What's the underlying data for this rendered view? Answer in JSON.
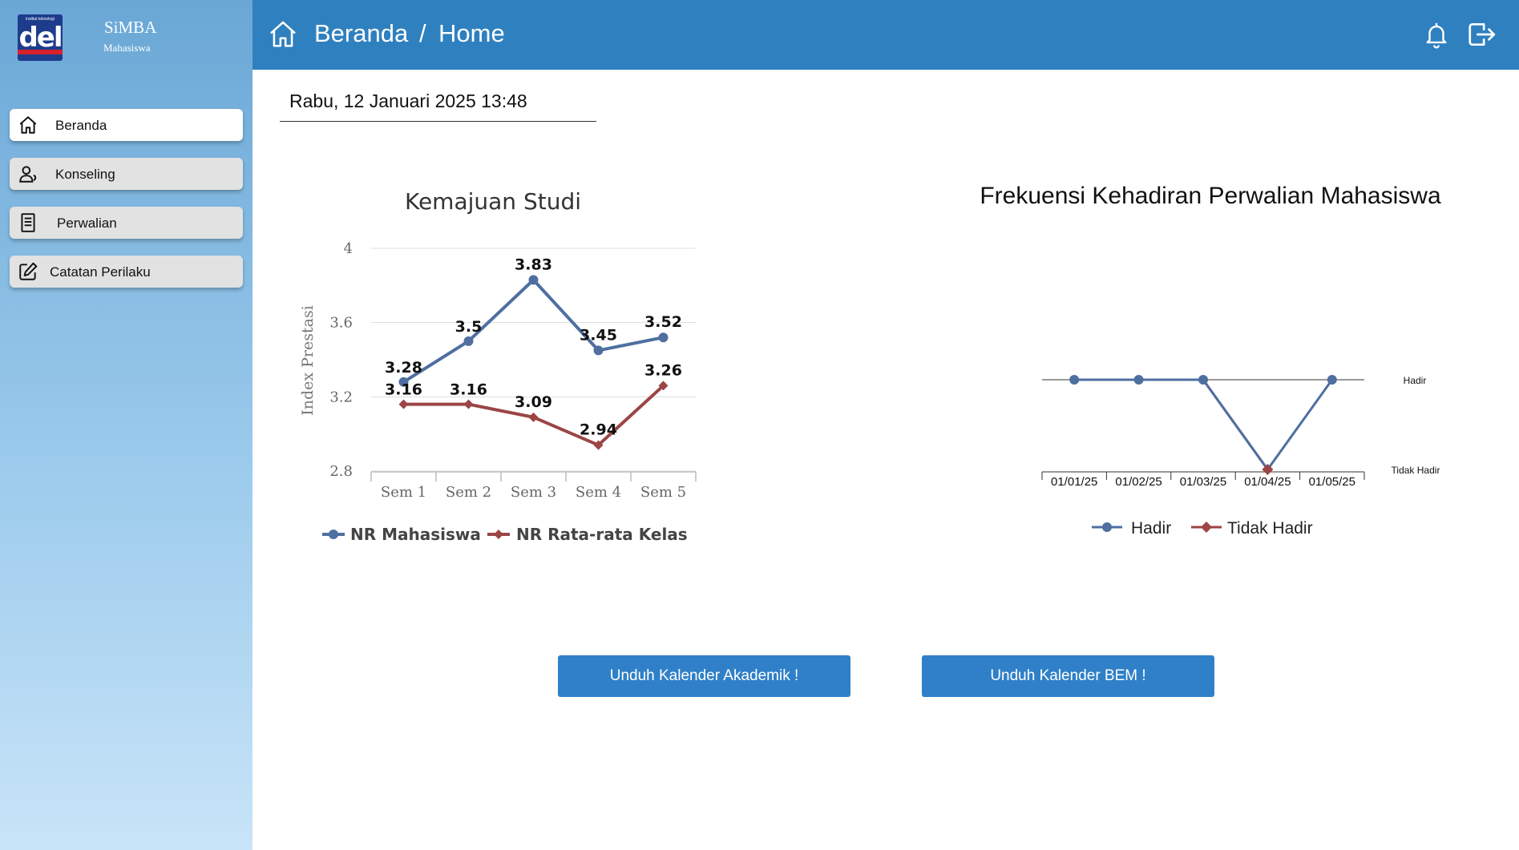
{
  "app": {
    "logo_top_text": "institut teknologi",
    "logo_text": "del",
    "title": "SiMBA",
    "subtitle": "Mahasiswa"
  },
  "sidebar": {
    "items": [
      {
        "label": "Beranda",
        "icon": "home-icon",
        "active": true
      },
      {
        "label": "Konseling",
        "icon": "user-icon",
        "active": false
      },
      {
        "label": "Perwalian",
        "icon": "document-icon",
        "active": false
      },
      {
        "label": "Catatan Perilaku",
        "icon": "edit-icon",
        "active": false
      }
    ]
  },
  "header": {
    "breadcrumb": [
      "Beranda",
      "/",
      "Home"
    ],
    "icons": [
      "home-icon",
      "bell-icon",
      "logout-icon"
    ]
  },
  "date_text": "Rabu, 12 Januari 2025 13:48",
  "colors": {
    "header": "#2f80bf",
    "series_blue": "#4e6fa0",
    "series_red": "#9c4545",
    "button": "#2f80c8"
  },
  "chart_data": [
    {
      "type": "line",
      "title": "Kemajuan Studi",
      "xlabel": "",
      "ylabel": "Index Prestasi",
      "categories": [
        "Sem 1",
        "Sem 2",
        "Sem 3",
        "Sem 4",
        "Sem 5"
      ],
      "y_ticks": [
        "4",
        "3.6",
        "3.2",
        "2.8"
      ],
      "ylim": [
        2.8,
        4
      ],
      "grid": true,
      "legend_position": "bottom",
      "series": [
        {
          "name": "NR Mahasiswa",
          "values": [
            3.28,
            3.5,
            3.83,
            3.45,
            3.52
          ],
          "labels": [
            "3.28",
            "3.5",
            "3.83",
            "3.45",
            "3.52"
          ]
        },
        {
          "name": "NR Rata-rata Kelas",
          "values": [
            3.16,
            3.16,
            3.09,
            2.94,
            3.26
          ],
          "labels": [
            "3.16",
            "3.16",
            "3.09",
            "2.94",
            "3.26"
          ]
        }
      ]
    },
    {
      "type": "line",
      "title": "Frekuensi Kehadiran Perwalian Mahasiswa",
      "xlabel": "",
      "ylabel": "",
      "categories": [
        "01/01/25",
        "01/02/25",
        "01/03/25",
        "01/04/25",
        "01/05/25"
      ],
      "y_categories": [
        "Tidak Hadir",
        "Hadir"
      ],
      "legend_position": "bottom",
      "series": [
        {
          "name": "Hadir",
          "points": [
            {
              "x": "01/01/25",
              "y": "Hadir"
            },
            {
              "x": "01/02/25",
              "y": "Hadir"
            },
            {
              "x": "01/03/25",
              "y": "Hadir"
            },
            {
              "x": "01/04/25",
              "y": "Tidak Hadir"
            },
            {
              "x": "01/05/25",
              "y": "Hadir"
            }
          ]
        },
        {
          "name": "Tidak Hadir",
          "points": [
            {
              "x": "01/03/25",
              "y": "Hadir"
            },
            {
              "x": "01/04/25",
              "y": "Tidak Hadir"
            }
          ]
        }
      ]
    }
  ],
  "buttons": {
    "academic_calendar": "Unduh Kalender Akademik !",
    "bem_calendar": "Unduh Kalender BEM !"
  }
}
